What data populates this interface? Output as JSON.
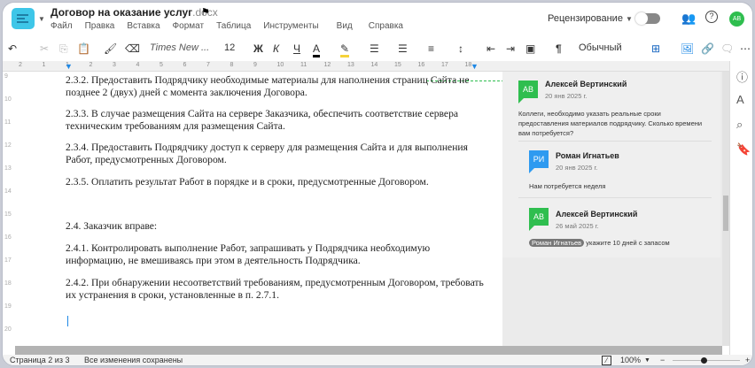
{
  "app": {
    "doc_name": "Договор на оказание услуг",
    "doc_ext": ".docx"
  },
  "menu": [
    "Файл",
    "Правка",
    "Вставка",
    "Формат",
    "Таблица",
    "Инструменты",
    "Вид",
    "Справка"
  ],
  "header": {
    "mode": "Рецензирование",
    "avatar": "АВ"
  },
  "toolbar": {
    "font": "Times New ...",
    "size": "12",
    "bold": "Ж",
    "italic": "К",
    "underline": "Ч",
    "style": "Обычный"
  },
  "ruler": [
    "2",
    "1",
    "1",
    "2",
    "3",
    "4",
    "5",
    "6",
    "7",
    "8",
    "9",
    "10",
    "11",
    "12",
    "13",
    "14",
    "15",
    "16",
    "17",
    "18"
  ],
  "line_numbers": [
    "9",
    "10",
    "11",
    "12",
    "13",
    "14",
    "15",
    "16",
    "17",
    "18",
    "19",
    "20"
  ],
  "document": {
    "lines": [
      "2.3.2. Предоставить Подрядчику необходимые материалы для наполнения страниц Сайта не",
      "позднее 2 (двух) дней с момента заключения Договора.",
      "2.3.3. В случае размещения Сайта на сервере Заказчика, обеспечить соответствие сервера",
      "техническим требованиям для размещения Сайта.",
      "2.3.4. Предоставить Подрядчику доступ к серверу для размещения Сайта и для выполнения",
      "Работ, предусмотренных Договором.",
      "2.3.5. Оплатить результат Работ в порядке и в сроки, предусмотренные Договором.",
      "2.4. Заказчик вправе:",
      "2.4.1. Контролировать выполнение Работ, запрашивать у Подрядчика необходимую",
      "информацию, не вмешиваясь при этом в деятельность Подрядчика.",
      "2.4.2. При обнаружении несоответствий требованиям, предусмотренным Договором, требовать",
      "их устранения в сроки, установленные в п. 2.7.1."
    ]
  },
  "comments": [
    {
      "initials": "АВ",
      "author": "Алексей Вертинский",
      "date": "20 янв 2025 г.",
      "text": "Коллеги, необходимо указать реальные сроки предоставления материалов подрядчику. Сколько времени вам потребуется?",
      "color": "#2fbe4f"
    },
    {
      "initials": "РИ",
      "author": "Роман Игнатьев",
      "date": "20 янв 2025 г.",
      "text": "Нам потребуется неделя",
      "color": "#2e9af0"
    },
    {
      "initials": "АВ",
      "author": "Алексей Вертинский",
      "date": "26 май 2025 г.",
      "mention": "Роман Игнатьев",
      "text": "укажите 10 дней с запасом",
      "color": "#2fbe4f"
    }
  ],
  "status": {
    "page": "Страница 2 из 3",
    "saved": "Все изменения сохранены",
    "zoom": "100%",
    "minus": "−",
    "plus": "+"
  },
  "colors": {
    "accent": "#2fbe4f"
  }
}
